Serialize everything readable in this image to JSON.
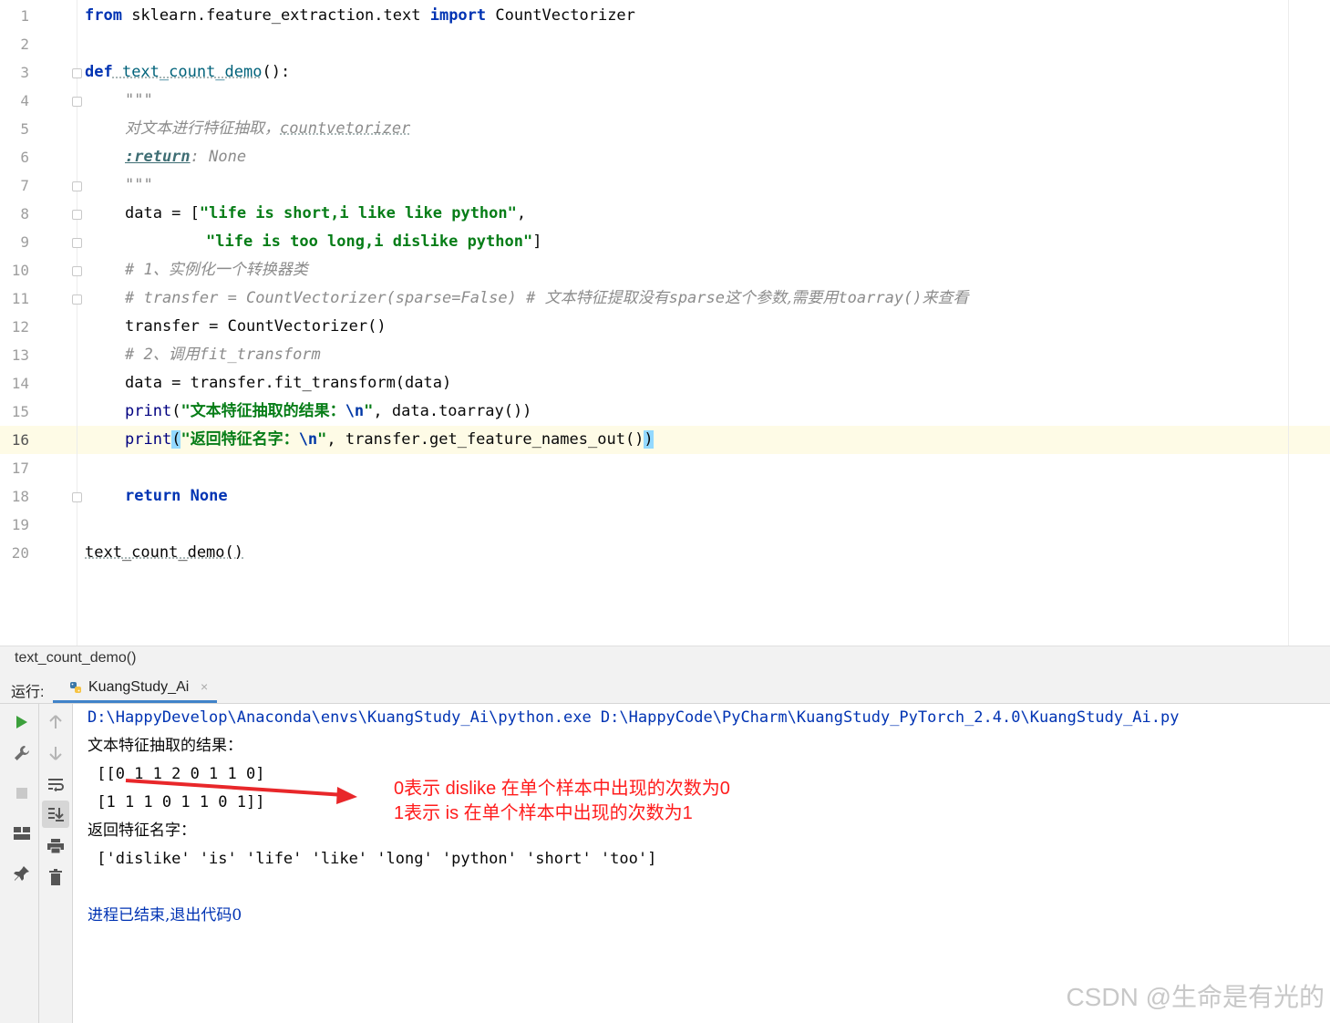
{
  "editor": {
    "line_numbers": [
      "1",
      "2",
      "3",
      "4",
      "5",
      "6",
      "7",
      "8",
      "9",
      "10",
      "11",
      "12",
      "13",
      "14",
      "15",
      "16",
      "17",
      "18",
      "19",
      "20"
    ],
    "l1": {
      "kw1": "from",
      "mod": " sklearn.feature_extraction.text ",
      "kw2": "import",
      "name": " CountVectorizer"
    },
    "l3": {
      "kw": "def",
      "fn": " text_count_demo",
      "rest": "():"
    },
    "l4": "\"\"\"",
    "l5": {
      "cn": "对文本进行特征抽取，",
      "en": "countvetorizer"
    },
    "l6": {
      "tag": ":return",
      "rest": ": None"
    },
    "l7": "\"\"\"",
    "l8": {
      "pre": "data = [",
      "s": "\"life is short,i like like python\"",
      "post": ","
    },
    "l9": {
      "s": "\"life is too long,i dislike python\"",
      "post": "]"
    },
    "l10": {
      "hash": "# 1、",
      "cn": "实例化一个转换器类"
    },
    "l11": {
      "a": "# transfer = CountVectorizer(sparse=False) # ",
      "b": "文本特征提取没有",
      "c": "sparse",
      "d": "这个参数,需要用",
      "e": "toarray()",
      "f": "来查看"
    },
    "l12": "transfer = CountVectorizer()",
    "l13": {
      "hash": "# 2、",
      "cn": "调用",
      "en": "fit_transform"
    },
    "l14": "data = transfer.fit_transform(data)",
    "l15": {
      "fn": "print",
      "p1": "(",
      "q": "\"",
      "cn": "文本特征抽取的结果：",
      "esc": "\\n",
      "q2": "\"",
      "rest": ", data.toarray())"
    },
    "l16": {
      "fn": "print",
      "p1": "(",
      "q": "\"",
      "cn": "返回特征名字：",
      "esc": "\\n",
      "q2": "\"",
      "rest": ", transfer.get_feature_names_out()",
      "p2": ")"
    },
    "l18": {
      "kw": "return",
      "rest": " None"
    },
    "l20": "text_count_demo()"
  },
  "status_bar": {
    "breadcrumb": "text_count_demo()"
  },
  "run_panel": {
    "label": "运行:",
    "tab_label": "KuangStudy_Ai",
    "tab_close": "×",
    "console": {
      "cmd": "D:\\HappyDevelop\\Anaconda\\envs\\KuangStudy_Ai\\python.exe D:\\HappyCode\\PyCharm\\KuangStudy_PyTorch_2.4.0\\KuangStudy_Ai.py",
      "out1": "文本特征抽取的结果：",
      "row1": " [[0 1 1 2 0 1 1 0]",
      "row2": " [1 1 1 0 1 1 0 1]]",
      "out2": "返回特征名字：",
      "names": " ['dislike' 'is' 'life' 'like' 'long' 'python' 'short' 'too']",
      "exit": "进程已结束,退出代码0"
    }
  },
  "annotation": {
    "line1": "0表示 dislike 在单个样本中出现的次数为0",
    "line2": "1表示 is 在单个样本中出现的次数为1",
    "color": "#ff1c1c"
  },
  "watermark": "CSDN @生命是有光的",
  "icons": [
    "run-icon",
    "wrench-icon",
    "stop-icon",
    "layout-icon",
    "pin-icon",
    "up-arrow-icon",
    "down-arrow-icon",
    "soft-wrap-icon",
    "scroll-to-end-icon",
    "print-icon",
    "trash-icon",
    "python-icon"
  ]
}
